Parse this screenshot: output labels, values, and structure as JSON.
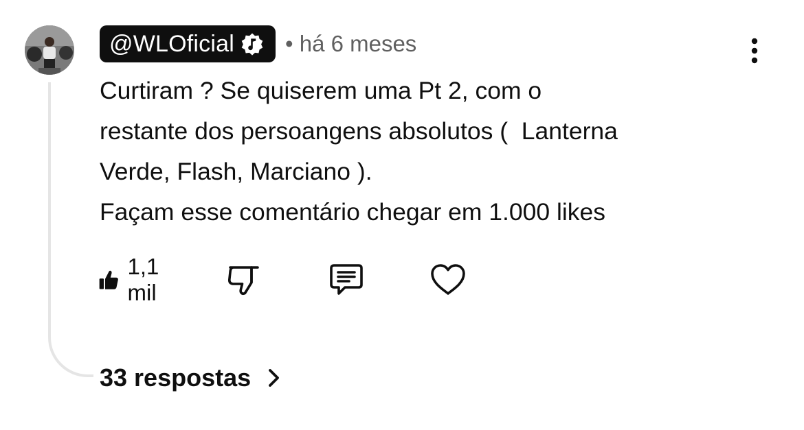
{
  "comment": {
    "author": "@WLOficial",
    "time_prefix": "•",
    "time": "há 6 meses",
    "text_lines": [
      "Curtiram ? Se quiserem uma Pt 2, com o",
      "restante dos persoangens absolutos (  Lanterna",
      "Verde, Flash, Marciano ).",
      "Façam esse comentário chegar em 1.000 likes"
    ],
    "like_count": "1,1 mil",
    "replies_label": "33 respostas"
  },
  "icons": {
    "avatar": "avatar",
    "verified": "music-note-verified-icon",
    "menu": "more-vert-icon",
    "like": "thumbs-up-filled-icon",
    "dislike": "thumbs-down-outline-icon",
    "reply": "comment-icon",
    "heart": "heart-outline-icon",
    "chevron": "chevron-right-icon"
  },
  "colors": {
    "text": "#0f0f0f",
    "secondary": "#606060",
    "chip_bg": "#0f0f0f",
    "thread_line": "#e5e5e5"
  }
}
